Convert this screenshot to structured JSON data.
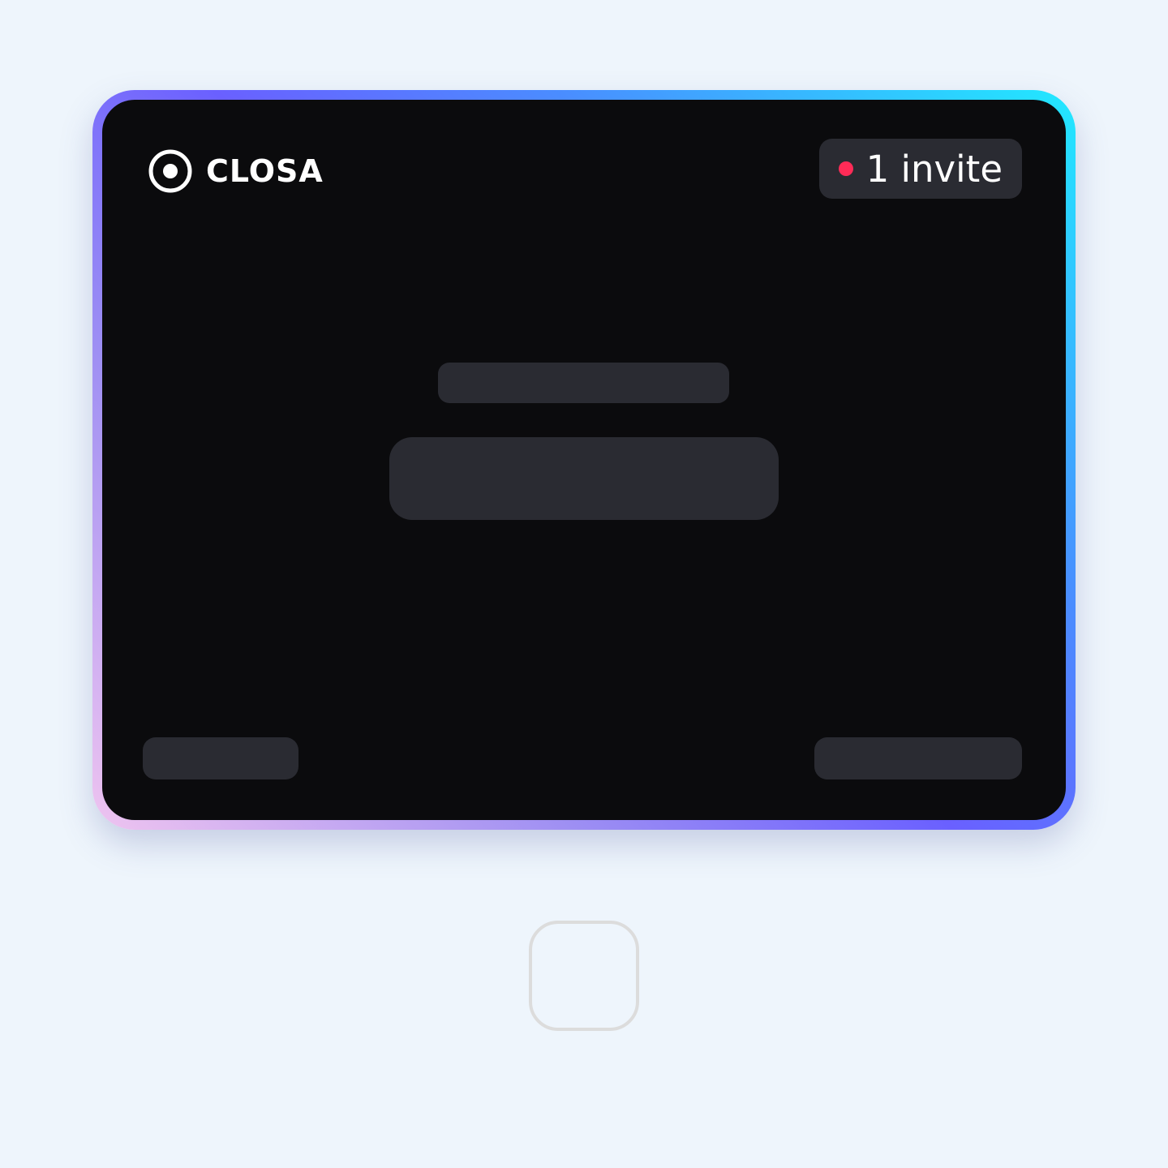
{
  "brand": {
    "name": "CLOSA",
    "icon": "target-icon"
  },
  "invite_badge": {
    "text": "1 invite",
    "dot_color": "#ff2b57"
  },
  "card": {
    "border_gradient": [
      "#21e9ff",
      "#4a8dff",
      "#6a60ff",
      "#9e8ff3",
      "#efc4f0"
    ],
    "background": "#0b0b0d",
    "placeholder_color": "#2a2b32"
  },
  "home_button": {
    "icon": "home-button-outline"
  }
}
